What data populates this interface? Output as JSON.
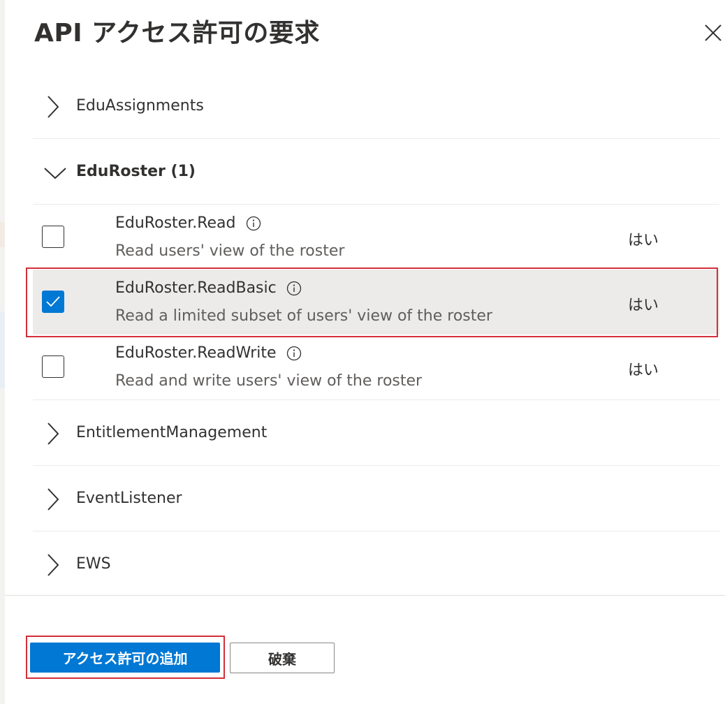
{
  "panel": {
    "title": "API アクセス許可の要求"
  },
  "groups_before": [
    {
      "name": "EduAssignments",
      "expanded": false
    }
  ],
  "expanded_group": {
    "name": "EduRoster (1)",
    "permissions": [
      {
        "name": "EduRoster.Read",
        "description": "Read users' view of the roster",
        "admin_consent": "はい",
        "checked": false
      },
      {
        "name": "EduRoster.ReadBasic",
        "description": "Read a limited subset of users' view of the roster",
        "admin_consent": "はい",
        "checked": true
      },
      {
        "name": "EduRoster.ReadWrite",
        "description": "Read and write users' view of the roster",
        "admin_consent": "はい",
        "checked": false
      }
    ]
  },
  "groups_after": [
    {
      "name": "EntitlementManagement",
      "expanded": false
    },
    {
      "name": "EventListener",
      "expanded": false
    },
    {
      "name": "EWS",
      "expanded": false
    }
  ],
  "footer": {
    "add_button_label": "アクセス許可の追加",
    "discard_button_label": "破棄"
  },
  "colors": {
    "primary": "#0078d4",
    "highlight_border": "#d32f3a",
    "selected_row": "#edebe9"
  }
}
